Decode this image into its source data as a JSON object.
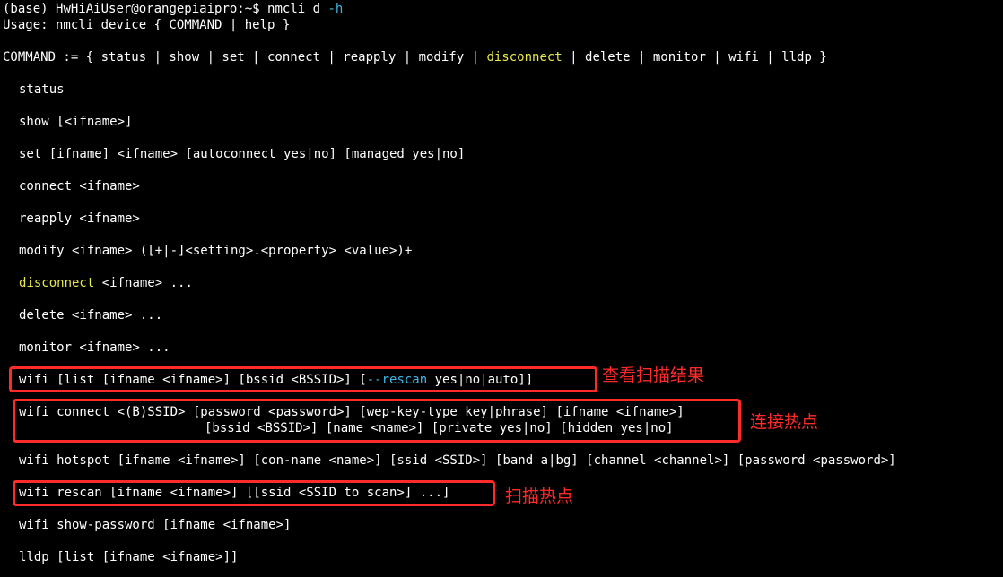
{
  "prompt": {
    "env": "(base)",
    "user_host": "HwHiAiUser@orangepiaipro:~$",
    "command": "nmcli d",
    "flag": "-h"
  },
  "usage": "Usage: nmcli device { COMMAND | help }",
  "command_list": {
    "prefix": "COMMAND := { status | show | set | connect | reapply | modify | ",
    "highlight": "disconnect",
    "suffix": " | delete | monitor | wifi | lldp }"
  },
  "entries": {
    "status": "status",
    "show": "show [<ifname>]",
    "set": "set [ifname] <ifname> [autoconnect yes|no] [managed yes|no]",
    "connect": "connect <ifname>",
    "reapply": "reapply <ifname>",
    "modify": "modify <ifname> ([+|-]<setting>.<property> <value>)+",
    "disconnect_cmd": "disconnect",
    "disconnect_rest": " <ifname> ...",
    "delete": "delete <ifname> ...",
    "monitor": "monitor <ifname> ...",
    "wifi_list_pre": "wifi [list [ifname <ifname>] [bssid <BSSID>] [",
    "wifi_list_opt": "--rescan",
    "wifi_list_post": " yes|no|auto]]",
    "wifi_connect_1": "wifi connect <(B)SSID> [password <password>] [wep-key-type key|phrase] [ifname <ifname>]",
    "wifi_connect_2": "[bssid <BSSID>] [name <name>] [private yes|no] [hidden yes|no]",
    "wifi_hotspot": "wifi hotspot [ifname <ifname>] [con-name <name>] [ssid <SSID>] [band a|bg] [channel <channel>] [password <password>]",
    "wifi_rescan": "wifi rescan [ifname <ifname>] [[ssid <SSID to scan>] ...]",
    "wifi_show_password": "wifi show-password [ifname <ifname>]",
    "lldp": "lldp [list [ifname <ifname>]]"
  },
  "annotations": {
    "view_scan_results": "查看扫描结果",
    "connect_hotspot": "连接热点",
    "scan_hotspot": "扫描热点"
  },
  "colors": {
    "background": "#000000",
    "text": "#ffffff",
    "highlight_yellow": "#e8e84a",
    "option_cyan": "#3fb7e8",
    "annotation_red": "#ff2a2a"
  }
}
